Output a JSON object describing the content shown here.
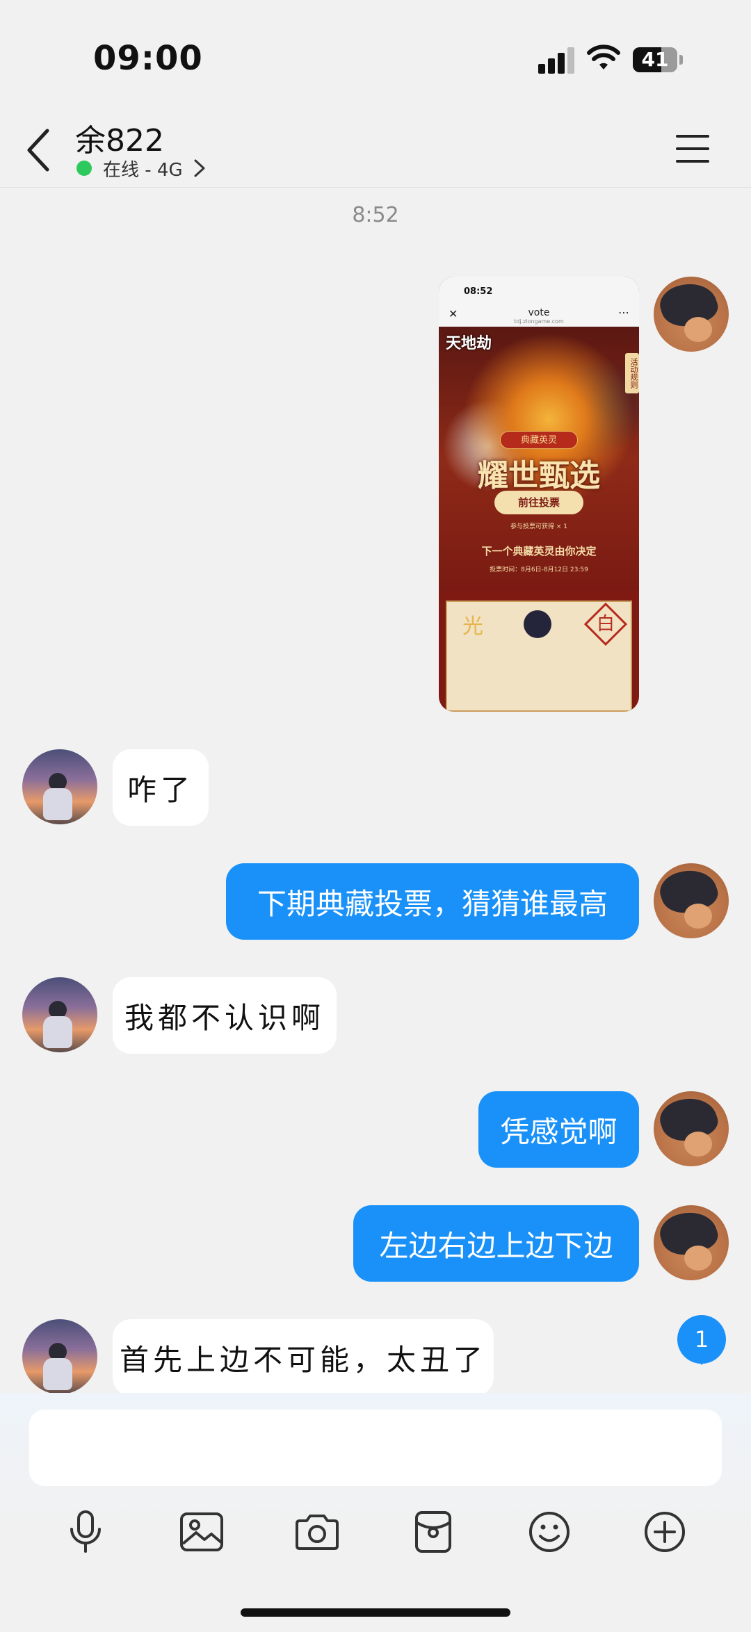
{
  "status_bar": {
    "time": "09:00",
    "battery": "41"
  },
  "header": {
    "contact_name": "余822",
    "status": "在线 - 4G"
  },
  "chat": {
    "timestamp": "8:52",
    "image_message": {
      "time": "08:52",
      "page_title": "vote",
      "page_url": "tdj.zlongame.com",
      "game_logo": "天地劫",
      "side_tag": "活动规则",
      "ribbon": "典藏英灵",
      "headline": "耀世甄选",
      "button": "前往投票",
      "reward_text": "参与投票可获得 × 1",
      "next_text": "下一个典藏英灵由你决定",
      "vote_time": "投票时间：8月6日-8月12日 23:59",
      "bottom_left": "光",
      "bottom_right": "白"
    },
    "messages": [
      {
        "sender": "other",
        "text": "咋了"
      },
      {
        "sender": "self",
        "text": "下期典藏投票，猜猜谁最高"
      },
      {
        "sender": "other",
        "text": "我都不认识啊"
      },
      {
        "sender": "self",
        "text": "凭感觉啊"
      },
      {
        "sender": "self",
        "text": "左边右边上边下边"
      },
      {
        "sender": "other",
        "text": "首先上边不可能，太丑了"
      }
    ],
    "unread_count": "1"
  },
  "input": {
    "placeholder": ""
  },
  "toolbar": {
    "icons": [
      "microphone-icon",
      "image-icon",
      "camera-icon",
      "red-packet-icon",
      "emoji-icon",
      "plus-icon"
    ]
  }
}
